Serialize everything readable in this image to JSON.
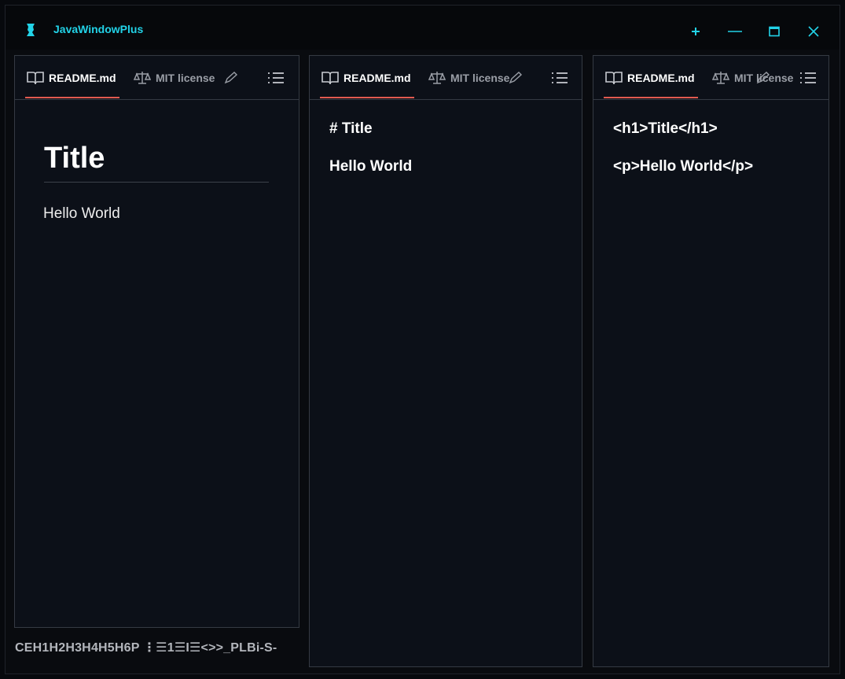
{
  "window": {
    "title": "JavaWindowPlus",
    "accent_color": "#22d3e8",
    "controls": {
      "add": "+",
      "minimize": "—",
      "maximize": "□",
      "close": "✕"
    }
  },
  "panes": [
    {
      "tabs": [
        {
          "label": "README.md",
          "icon": "book-icon",
          "active": true
        },
        {
          "label": "MIT license",
          "icon": "scales-icon",
          "active": false
        }
      ],
      "preview": {
        "heading": "Title",
        "paragraph": "Hello World"
      }
    },
    {
      "tabs": [
        {
          "label": "README.md",
          "icon": "book-icon",
          "active": true
        },
        {
          "label": "MIT license",
          "icon": "scales-icon",
          "active": false
        }
      ],
      "source": [
        "# Title",
        "Hello World"
      ]
    },
    {
      "tabs": [
        {
          "label": "README.md",
          "icon": "book-icon",
          "active": true
        },
        {
          "label": "MIT license",
          "icon": "scales-icon",
          "active": false
        }
      ],
      "html": [
        "<h1>Title</h1>",
        "<p>Hello World</p>"
      ]
    }
  ],
  "toolbar": {
    "text": "CEH1H2H3H4H5H6P ⋮☰1☰I☰<>>_PLBi-S-"
  },
  "colors": {
    "tab_underline": "#e05a50",
    "pane_border": "#353a43",
    "pane_background": "#0c1018"
  }
}
